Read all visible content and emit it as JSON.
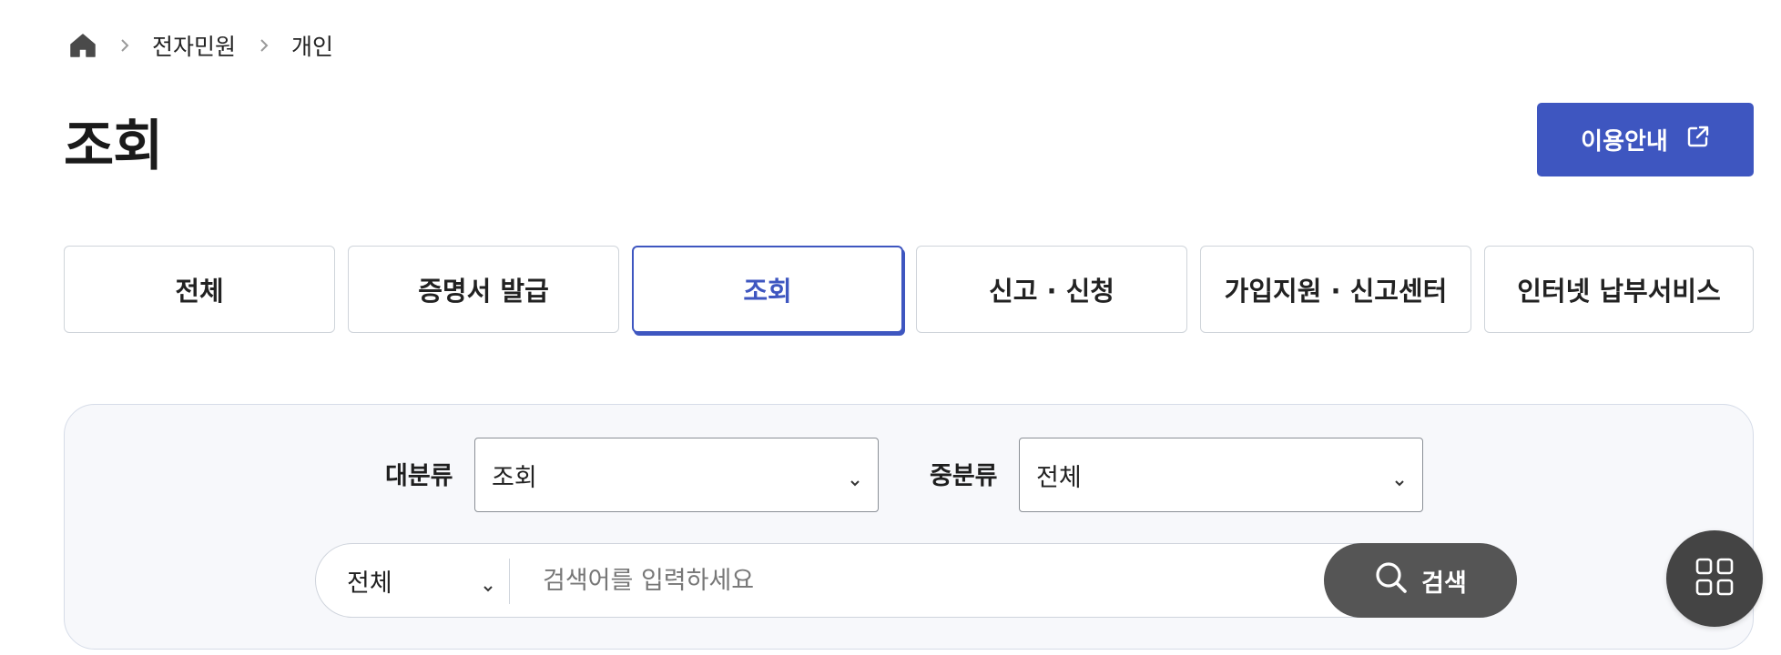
{
  "breadcrumb": {
    "home_icon": "home-icon",
    "items": [
      "전자민원",
      "개인"
    ]
  },
  "page": {
    "title": "조회",
    "guide_button": "이용안내",
    "guide_icon": "external-link-icon"
  },
  "tabs": [
    {
      "label": "전체",
      "active": false
    },
    {
      "label": "증명서 발급",
      "active": false
    },
    {
      "label": "조회",
      "active": true
    },
    {
      "label": "신고 · 신청",
      "active": false
    },
    {
      "label": "가입지원 · 신고센터",
      "active": false
    },
    {
      "label": "인터넷 납부서비스",
      "active": false
    }
  ],
  "filters": {
    "major_label": "대분류",
    "major_value": "조회",
    "middle_label": "중분류",
    "middle_value": "전체"
  },
  "search": {
    "scope_value": "전체",
    "placeholder": "검색어를 입력하세요",
    "button_label": "검색",
    "button_icon": "search-icon"
  },
  "fab": {
    "icon": "grid-menu-icon"
  },
  "colors": {
    "accent": "#3e56c0",
    "panel_bg": "#f7f8fb",
    "search_button": "#555555",
    "fab": "#444444"
  }
}
